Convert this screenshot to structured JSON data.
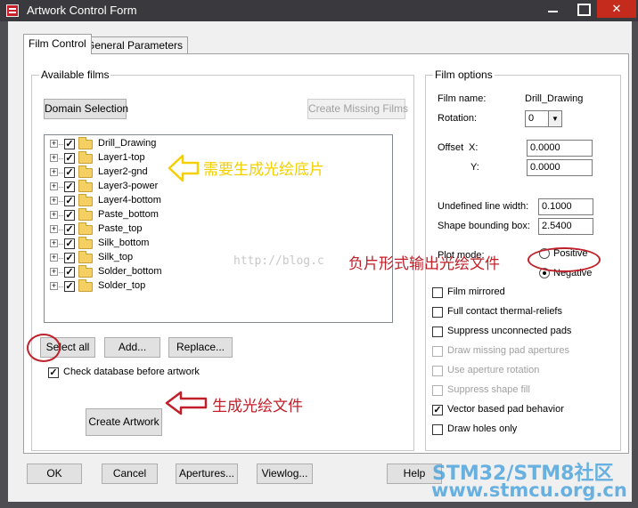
{
  "window": {
    "title": "Artwork Control Form"
  },
  "tabs": [
    {
      "label": "Film Control",
      "active": true
    },
    {
      "label": "General Parameters",
      "active": false
    }
  ],
  "available_films": {
    "legend": "Available films",
    "domain_selection_label": "Domain Selection",
    "create_missing_label": "Create Missing Films",
    "films": [
      {
        "name": "Drill_Drawing",
        "checked": true
      },
      {
        "name": "Layer1-top",
        "checked": true
      },
      {
        "name": "Layer2-gnd",
        "checked": true
      },
      {
        "name": "Layer3-power",
        "checked": true
      },
      {
        "name": "Layer4-bottom",
        "checked": true
      },
      {
        "name": "Paste_bottom",
        "checked": true
      },
      {
        "name": "Paste_top",
        "checked": true
      },
      {
        "name": "Silk_bottom",
        "checked": true
      },
      {
        "name": "Silk_top",
        "checked": true
      },
      {
        "name": "Solder_bottom",
        "checked": true
      },
      {
        "name": "Solder_top",
        "checked": true
      }
    ],
    "select_all_label": "Select all",
    "add_label": "Add...",
    "replace_label": "Replace...",
    "check_db_label": "Check database before artwork",
    "check_db_checked": true,
    "create_artwork_label": "Create Artwork"
  },
  "film_options": {
    "legend": "Film options",
    "film_name_label": "Film name:",
    "film_name_value": "Drill_Drawing",
    "rotation_label": "Rotation:",
    "rotation_value": "0",
    "offset_label": "Offset",
    "x_label": "X:",
    "x_value": "0.0000",
    "y_label": "Y:",
    "y_value": "0.0000",
    "undefined_line_width_label": "Undefined line width:",
    "undefined_line_width_value": "0.1000",
    "shape_bounding_box_label": "Shape bounding box:",
    "shape_bounding_box_value": "2.5400",
    "plot_mode_label": "Plot mode:",
    "positive_label": "Positive",
    "negative_label": "Negative",
    "plot_mode_value": "Negative",
    "checkboxes": [
      {
        "label": "Film mirrored",
        "checked": false,
        "enabled": true
      },
      {
        "label": "Full contact thermal-reliefs",
        "checked": false,
        "enabled": true
      },
      {
        "label": "Suppress unconnected pads",
        "checked": false,
        "enabled": true
      },
      {
        "label": "Draw missing pad apertures",
        "checked": false,
        "enabled": false
      },
      {
        "label": "Use aperture rotation",
        "checked": false,
        "enabled": false
      },
      {
        "label": "Suppress shape fill",
        "checked": false,
        "enabled": false
      },
      {
        "label": "Vector based pad behavior",
        "checked": true,
        "enabled": true
      },
      {
        "label": "Draw holes only",
        "checked": false,
        "enabled": true
      }
    ]
  },
  "bottom_buttons": {
    "ok": "OK",
    "cancel": "Cancel",
    "apertures": "Apertures...",
    "viewlog": "Viewlog...",
    "help": "Help"
  },
  "annotations": {
    "films_note": "需要生成光绘底片",
    "negative_note": "负片形式输出光绘文件",
    "create_note": "生成光绘文件",
    "yellow": "#f5d000",
    "red": "#c0202a"
  },
  "watermarks": {
    "url": "http://blog.c",
    "brand": "STM32/STM8社区",
    "site": "www.stmcu.org.cn"
  }
}
